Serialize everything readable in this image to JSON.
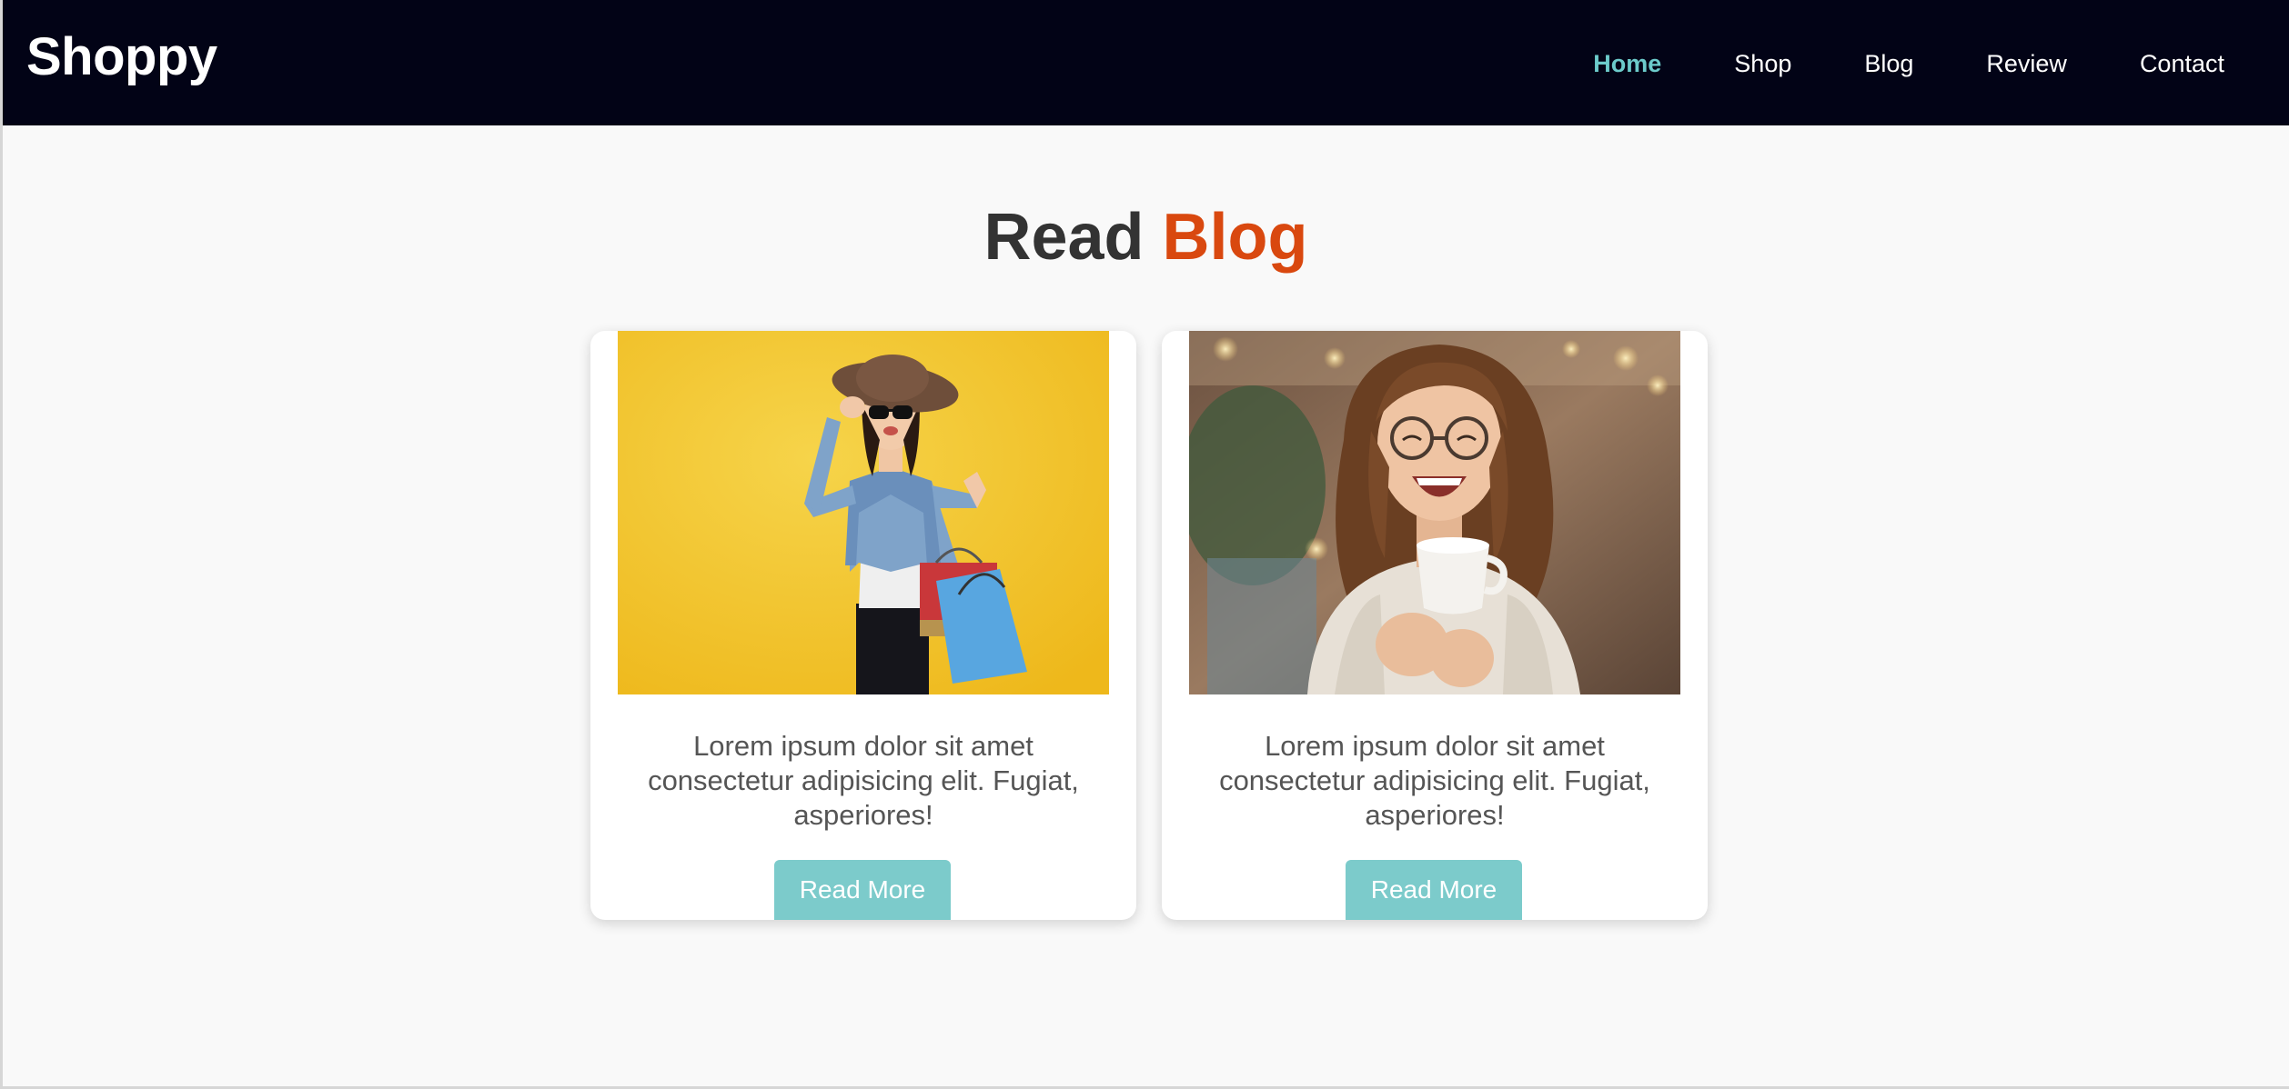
{
  "brand": {
    "name": "Shoppy"
  },
  "nav": {
    "items": [
      {
        "label": "Home",
        "active": true
      },
      {
        "label": "Shop"
      },
      {
        "label": "Blog"
      },
      {
        "label": "Review"
      },
      {
        "label": "Contact"
      }
    ]
  },
  "section": {
    "title_part1": "Read",
    "title_part2": "Blog"
  },
  "cards": [
    {
      "text": "Lorem ipsum dolor sit amet consectetur adipisicing elit. Fugiat, asperiores!",
      "button_label": "Read More"
    },
    {
      "text": "Lorem ipsum dolor sit amet consectetur adipisicing elit. Fugiat, asperiores!",
      "button_label": "Read More"
    }
  ],
  "colors": {
    "header_bg": "#020316",
    "nav_active": "#6ccbcb",
    "title_accent": "#d9480f",
    "button_bg": "#7ccbcb",
    "page_bg": "#f9f9f9"
  }
}
